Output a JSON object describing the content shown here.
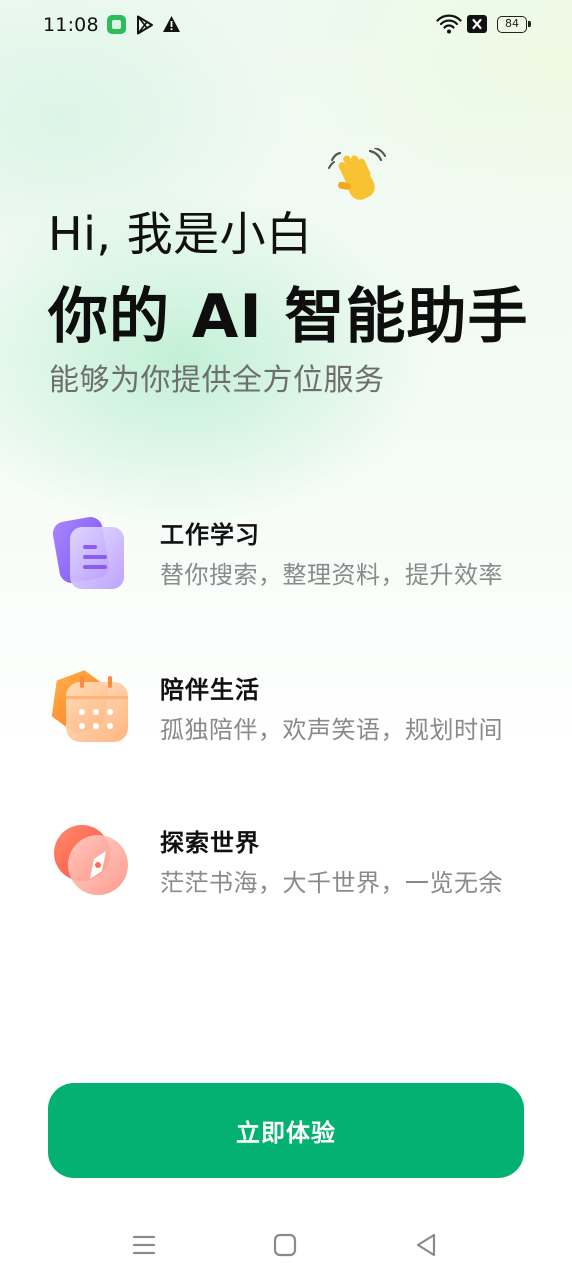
{
  "status_bar": {
    "time": "11:08",
    "battery": "84",
    "icons": [
      "app-notification-icon",
      "play-store-icon",
      "warning-icon",
      "wifi-icon",
      "close-box-icon",
      "battery-icon"
    ]
  },
  "hero": {
    "greeting": "Hi, 我是小白",
    "title": "你的 AI 智能助手",
    "subtitle": "能够为你提供全方位服务",
    "emoji": "waving-hand-icon"
  },
  "features": [
    {
      "title": "工作学习",
      "desc": "替你搜索，整理资料，提升效率",
      "icon": "document-icon",
      "color": "#9b6cf6"
    },
    {
      "title": "陪伴生活",
      "desc": "孤独陪伴，欢声笑语，规划时间",
      "icon": "calendar-icon",
      "color": "#ff8a3d"
    },
    {
      "title": "探索世界",
      "desc": "茫茫书海，大千世界，一览无余",
      "icon": "compass-icon",
      "color": "#ff5a4f"
    }
  ],
  "cta": {
    "label": "立即体验",
    "color": "#03b173"
  },
  "nav": [
    "menu-icon",
    "home-icon",
    "back-icon"
  ]
}
